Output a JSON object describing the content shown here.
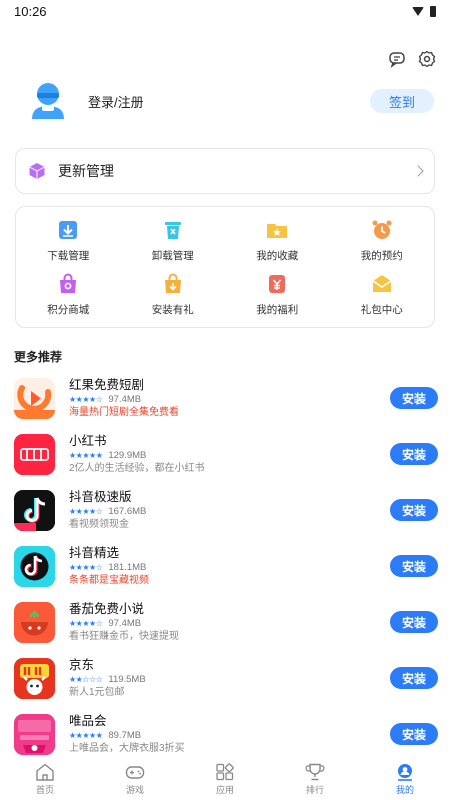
{
  "status_bar": {
    "time": "10:26"
  },
  "profile": {
    "login_label": "登录/注册",
    "sign_in_label": "签到"
  },
  "update": {
    "label": "更新管理"
  },
  "grid": [
    {
      "label": "下载管理",
      "icon": "download-icon",
      "color": "#4a9bf5"
    },
    {
      "label": "卸载管理",
      "icon": "trash-icon",
      "color": "#3cc4e6"
    },
    {
      "label": "我的收藏",
      "icon": "folder-star-icon",
      "color": "#f6c343"
    },
    {
      "label": "我的预约",
      "icon": "alarm-clock-icon",
      "color": "#f59a4a"
    },
    {
      "label": "积分商城",
      "icon": "shop-bag-icon",
      "color": "#c45ef0"
    },
    {
      "label": "安装有礼",
      "icon": "gift-bag-icon",
      "color": "#f6b03c"
    },
    {
      "label": "我的福利",
      "icon": "welfare-icon",
      "color": "#f06a5e"
    },
    {
      "label": "礼包中心",
      "icon": "gift-box-icon",
      "color": "#f6c343"
    }
  ],
  "section_title": "更多推荐",
  "apps": [
    {
      "name": "红果免费短剧",
      "rating": 4,
      "size": "97.4MB",
      "desc": "海量热门短剧全集免费看",
      "hot": true,
      "icon": "hongguo-app-icon"
    },
    {
      "name": "小红书",
      "rating": 5,
      "size": "129.9MB",
      "desc": "2亿人的生活经验，都在小红书",
      "hot": false,
      "icon": "xiaohongshu-app-icon"
    },
    {
      "name": "抖音极速版",
      "rating": 4,
      "size": "167.6MB",
      "desc": "看视频领现金",
      "hot": false,
      "icon": "douyin-lite-app-icon"
    },
    {
      "name": "抖音精选",
      "rating": 4,
      "size": "181.1MB",
      "desc": "条条都是宝藏视频",
      "hot": true,
      "icon": "douyin-select-app-icon"
    },
    {
      "name": "番茄免费小说",
      "rating": 4,
      "size": "97.4MB",
      "desc": "看书狂赚金币，快速提现",
      "hot": false,
      "icon": "fanqie-app-icon"
    },
    {
      "name": "京东",
      "rating": 2,
      "size": "119.5MB",
      "desc": "新人1元包邮",
      "hot": false,
      "icon": "jd-app-icon"
    },
    {
      "name": "唯品会",
      "rating": 5,
      "size": "89.7MB",
      "desc": "上唯品会，大牌衣服3折买",
      "hot": false,
      "icon": "vip-app-icon"
    }
  ],
  "install_label": "安装",
  "nav": [
    {
      "label": "首页",
      "icon": "home-icon",
      "active": false
    },
    {
      "label": "游戏",
      "icon": "gamepad-icon",
      "active": false
    },
    {
      "label": "应用",
      "icon": "apps-icon",
      "active": false
    },
    {
      "label": "排行",
      "icon": "trophy-icon",
      "active": false
    },
    {
      "label": "我的",
      "icon": "profile-icon",
      "active": true
    }
  ]
}
